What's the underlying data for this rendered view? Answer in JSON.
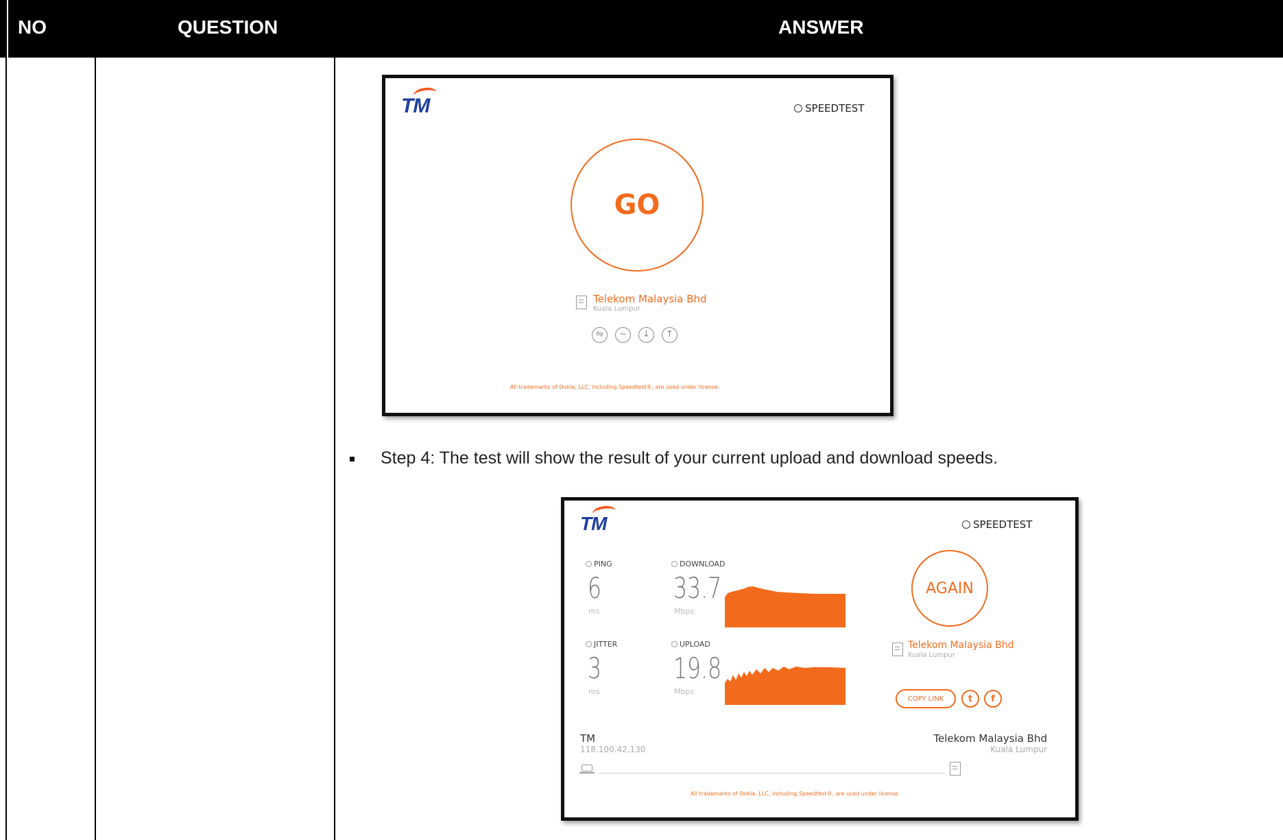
{
  "table": {
    "headers": {
      "no": "NO",
      "question": "QUESTION",
      "answer": "ANSWER"
    }
  },
  "screenshot1": {
    "logo": "TM",
    "speedtest": "SPEEDTEST",
    "go": "GO",
    "server_name": "Telekom Malaysia Bhd",
    "server_location": "Kuala Lumpur",
    "trademark": "All trademarks of Ookla, LLC, including Speedtest®, are used under license."
  },
  "step4": "Step 4: The test will show the result of your current upload and download speeds.",
  "screenshot2": {
    "logo": "TM",
    "speedtest": "SPEEDTEST",
    "ping_label": "PING",
    "ping_value": "6",
    "ping_unit": "ms",
    "jitter_label": "JITTER",
    "jitter_value": "3",
    "jitter_unit": "ms",
    "download_label": "DOWNLOAD",
    "download_value": "33.7",
    "download_unit": "Mbps",
    "upload_label": "UPLOAD",
    "upload_value": "19.8",
    "upload_unit": "Mbps",
    "again": "AGAIN",
    "server_name": "Telekom Malaysia Bhd",
    "server_location": "Kuala Lumpur",
    "copy_link": "COPY LINK",
    "twitter": "t",
    "facebook": "f",
    "isp_name": "TM",
    "isp_ip": "118.100.42.130",
    "host_name": "Telekom Malaysia Bhd",
    "host_location": "Kuala Lumpur",
    "trademark": "All trademarks of Ookla, LLC, including Speedtest®, are used under license."
  },
  "colors": {
    "accent": "#f26b1d",
    "logo_blue": "#1e3f9e",
    "header_bg": "#000000"
  }
}
